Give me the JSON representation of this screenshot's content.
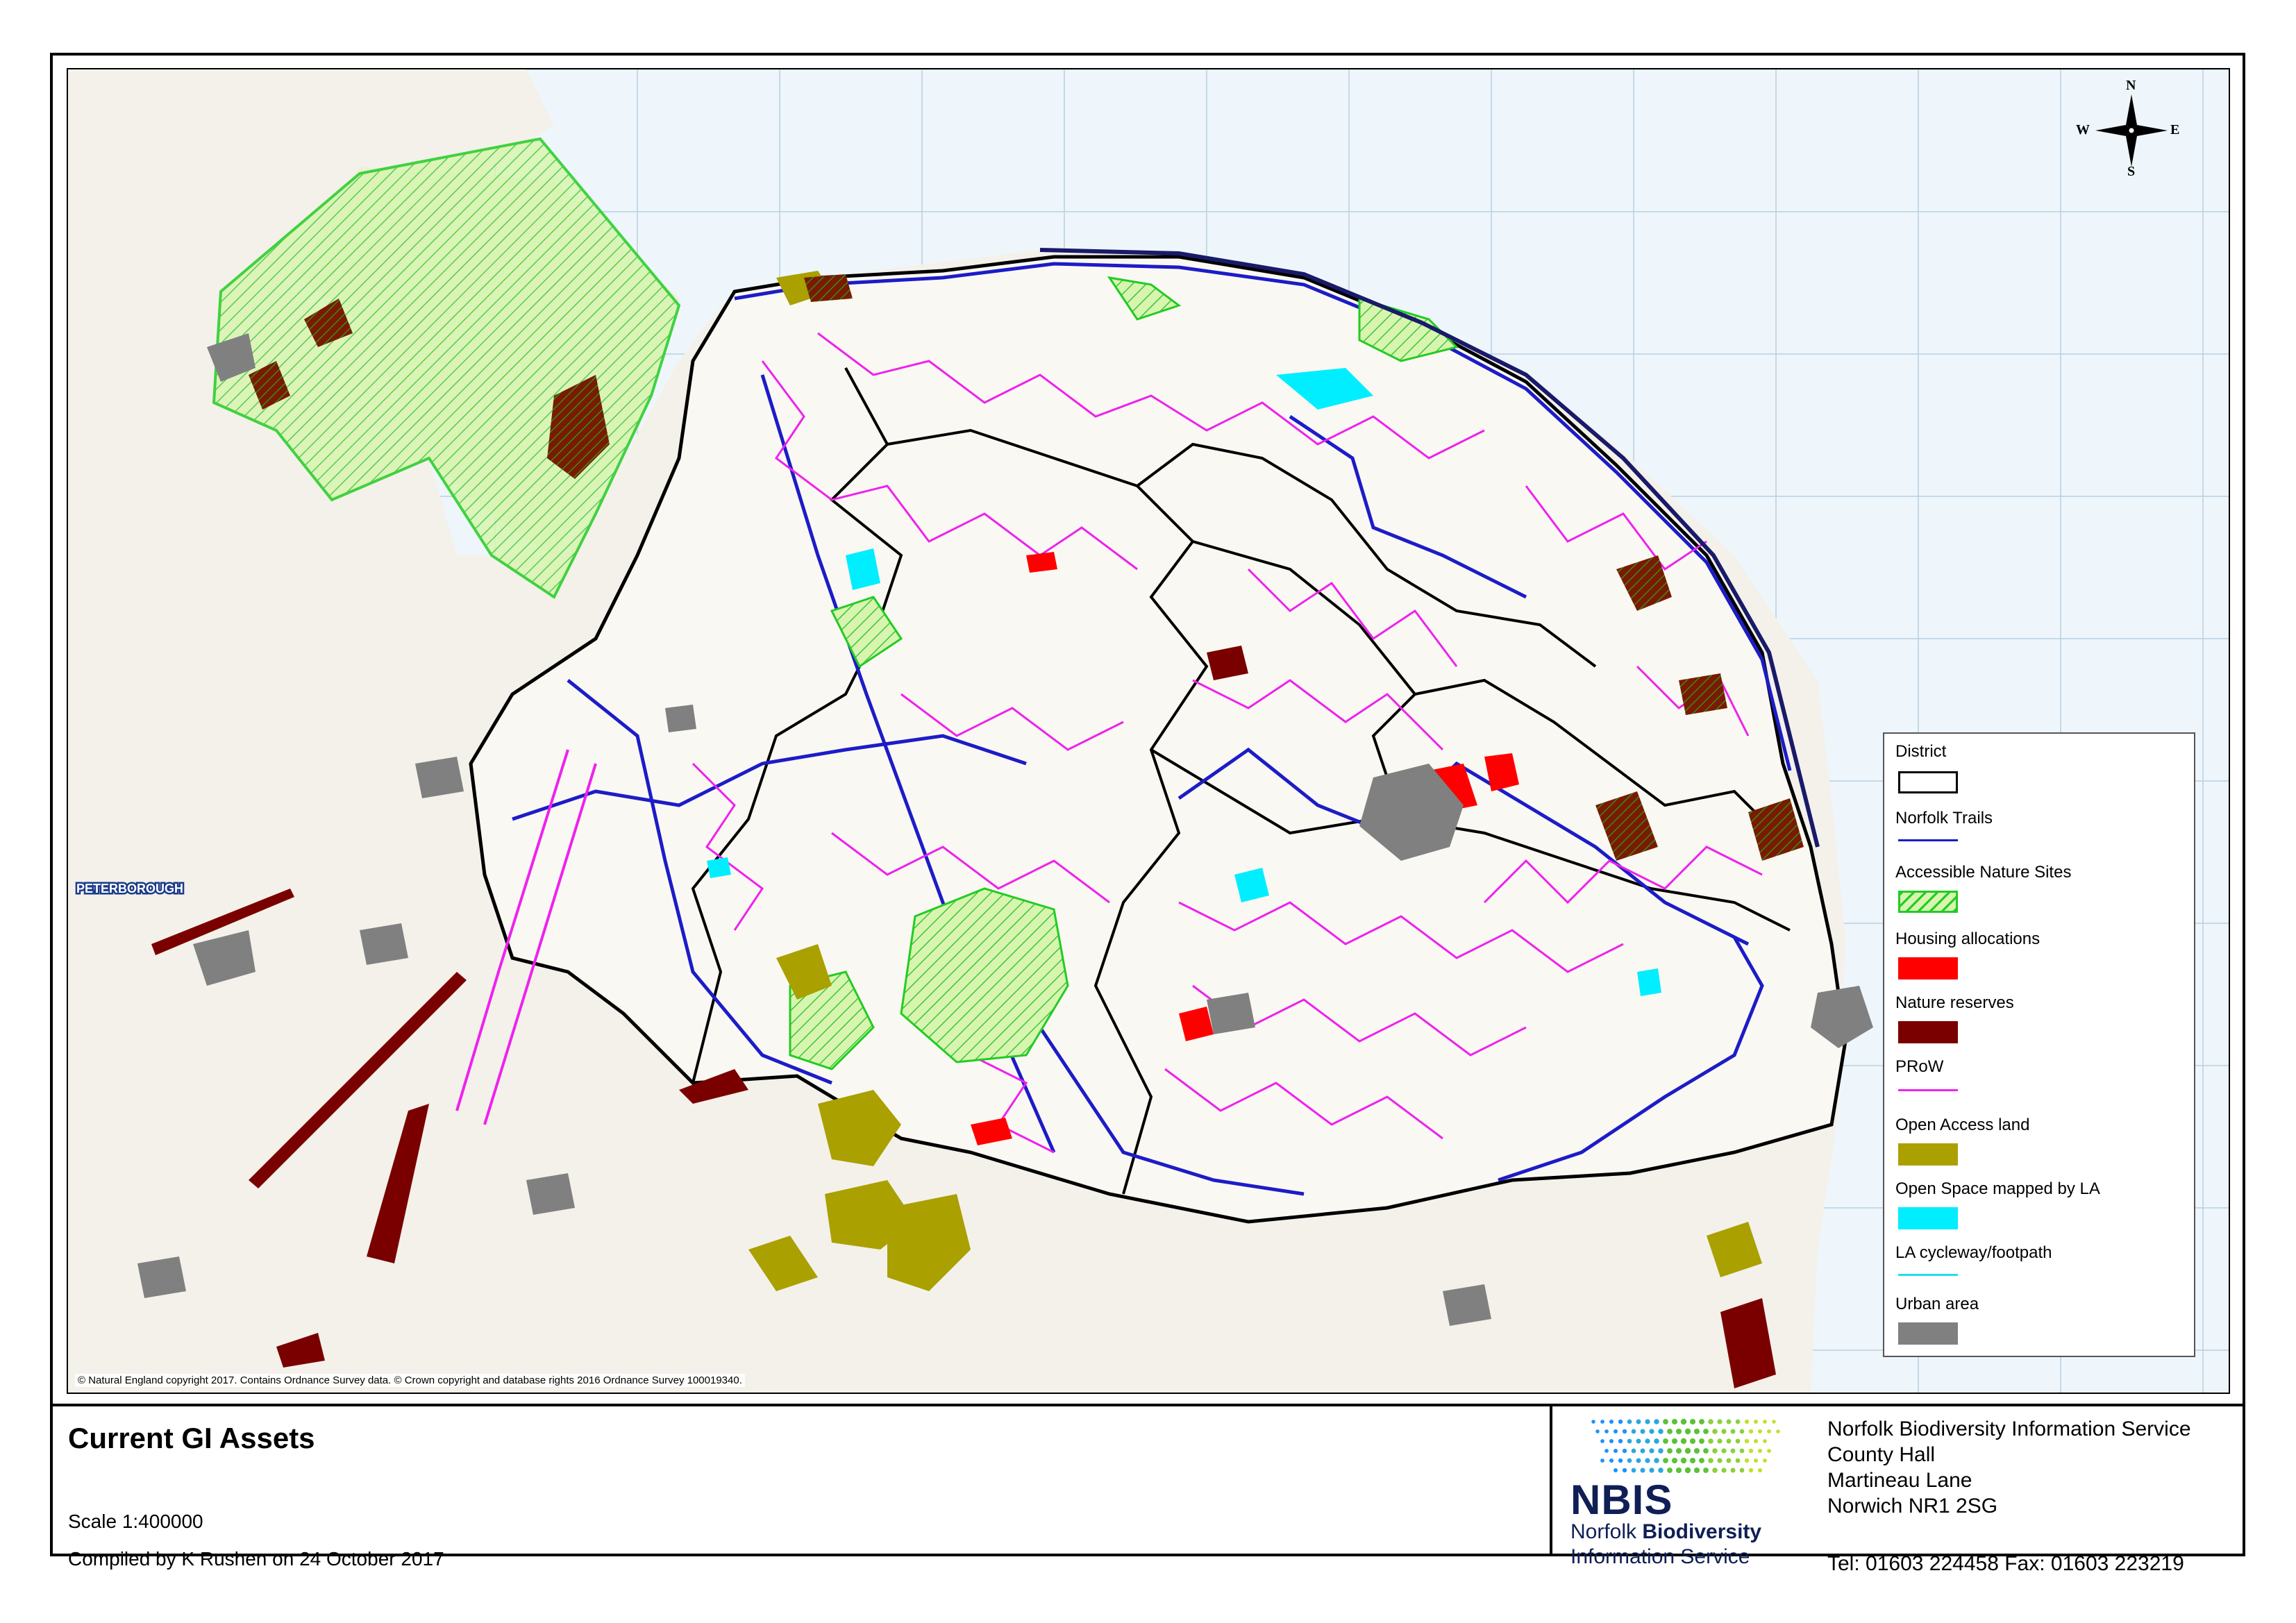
{
  "map": {
    "copyright": "© Natural England copyright 2017. Contains Ordnance Survey data. © Crown copyright and database rights 2016 Ordnance Survey 100019340.",
    "compass": {
      "n": "N",
      "s": "S",
      "e": "E",
      "w": "W"
    },
    "place_labels": [
      "PETERBOROUGH"
    ]
  },
  "legend": {
    "items": [
      {
        "label": "District",
        "symbol": "outline",
        "color": "#000000"
      },
      {
        "label": "Norfolk Trails",
        "symbol": "line",
        "color": "#1c1cc8"
      },
      {
        "label": "Accessible Nature Sites",
        "symbol": "hatch",
        "color": "#22cc22"
      },
      {
        "label": "Housing allocations",
        "symbol": "fill",
        "color": "#ff0000"
      },
      {
        "label": "Nature reserves",
        "symbol": "fill",
        "color": "#7a0000"
      },
      {
        "label": "PRoW",
        "symbol": "line",
        "color": "#ee22ee"
      },
      {
        "label": "Open Access land",
        "symbol": "fill",
        "color": "#aaa000"
      },
      {
        "label": "Open Space mapped by LA",
        "symbol": "fill",
        "color": "#00eeff"
      },
      {
        "label": "LA cycleway/footpath",
        "symbol": "line",
        "color": "#22ddee"
      },
      {
        "label": "Urban area",
        "symbol": "fill",
        "color": "#808080"
      }
    ]
  },
  "title_panel": {
    "title": "Current GI Assets",
    "scale": "Scale 1:400000",
    "compiled": "Compiled by K Rushen on 24 October 2017"
  },
  "organisation": {
    "logo_text": "NBIS",
    "logo_sub1_a": "Norfolk ",
    "logo_sub1_b": "Biodiversity",
    "logo_sub2": "Information Service",
    "address_lines": [
      "Norfolk Biodiversity Information Service",
      "County Hall",
      "Martineau Lane",
      "Norwich NR1 2SG"
    ],
    "contact": "Tel: 01603 224458  Fax: 01603 223219"
  }
}
